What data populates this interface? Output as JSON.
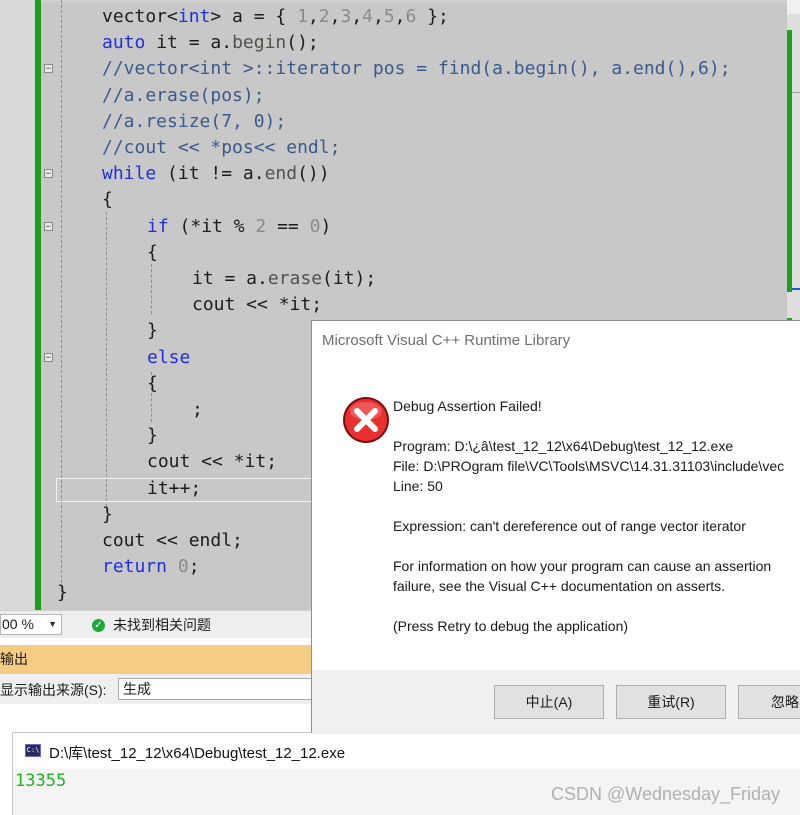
{
  "editor": {
    "lines": [
      {
        "indent": 0,
        "tokens": [
          {
            "t": "vector<"
          },
          {
            "t": "int",
            "c": "kw"
          },
          {
            "t": "> a = { "
          },
          {
            "t": "1",
            "c": "num"
          },
          {
            "t": ","
          },
          {
            "t": "2",
            "c": "num"
          },
          {
            "t": ","
          },
          {
            "t": "3",
            "c": "num"
          },
          {
            "t": ","
          },
          {
            "t": "4",
            "c": "num"
          },
          {
            "t": ","
          },
          {
            "t": "5",
            "c": "num"
          },
          {
            "t": ","
          },
          {
            "t": "6",
            "c": "num"
          },
          {
            "t": " };"
          }
        ]
      },
      {
        "indent": 0,
        "tokens": [
          {
            "t": "auto",
            "c": "kw"
          },
          {
            "t": " it = a."
          },
          {
            "t": "begin",
            "c": "fn"
          },
          {
            "t": "();"
          }
        ]
      },
      {
        "indent": 0,
        "fold": true,
        "tokens": [
          {
            "t": "//vector<int >::iterator pos = find(a.begin(), a.end(),6);",
            "c": "cm"
          }
        ]
      },
      {
        "indent": 0,
        "tokens": [
          {
            "t": "//a.erase(pos);",
            "c": "cm"
          }
        ]
      },
      {
        "indent": 0,
        "tokens": [
          {
            "t": "//a.resize(7, 0);",
            "c": "cm"
          }
        ]
      },
      {
        "indent": 0,
        "tokens": [
          {
            "t": "//cout << *pos<< endl;",
            "c": "cm"
          }
        ]
      },
      {
        "indent": 0,
        "fold": true,
        "tokens": [
          {
            "t": "while",
            "c": "kw"
          },
          {
            "t": " (it != a."
          },
          {
            "t": "end",
            "c": "fn"
          },
          {
            "t": "())"
          }
        ]
      },
      {
        "indent": 0,
        "tokens": [
          {
            "t": "{"
          }
        ]
      },
      {
        "indent": 1,
        "fold": true,
        "tokens": [
          {
            "t": "if",
            "c": "kw"
          },
          {
            "t": " (*it % "
          },
          {
            "t": "2",
            "c": "num"
          },
          {
            "t": " == "
          },
          {
            "t": "0",
            "c": "num"
          },
          {
            "t": ")"
          }
        ]
      },
      {
        "indent": 1,
        "tokens": [
          {
            "t": "{"
          }
        ]
      },
      {
        "indent": 2,
        "tokens": [
          {
            "t": "it = a."
          },
          {
            "t": "erase",
            "c": "fn"
          },
          {
            "t": "(it);"
          }
        ]
      },
      {
        "indent": 2,
        "tokens": [
          {
            "t": "cout << *it;"
          }
        ]
      },
      {
        "indent": 1,
        "tokens": [
          {
            "t": "}"
          }
        ]
      },
      {
        "indent": 1,
        "fold": true,
        "tokens": [
          {
            "t": "else",
            "c": "kw"
          }
        ]
      },
      {
        "indent": 1,
        "tokens": [
          {
            "t": "{"
          }
        ]
      },
      {
        "indent": 2,
        "tokens": [
          {
            "t": ";"
          }
        ]
      },
      {
        "indent": 1,
        "tokens": [
          {
            "t": "}"
          }
        ]
      },
      {
        "indent": 1,
        "tokens": [
          {
            "t": "cout << *it;"
          }
        ]
      },
      {
        "indent": 1,
        "tokens": [
          {
            "t": "it++;"
          }
        ]
      },
      {
        "indent": 0,
        "tokens": [
          {
            "t": "}"
          }
        ]
      },
      {
        "indent": 0,
        "tokens": [
          {
            "t": "cout << endl;"
          }
        ]
      },
      {
        "indent": 0,
        "tokens": [
          {
            "t": "return",
            "c": "kw"
          },
          {
            "t": " "
          },
          {
            "t": "0",
            "c": "num"
          },
          {
            "t": ";"
          }
        ]
      },
      {
        "indent": -1,
        "tokens": [
          {
            "t": "}"
          }
        ]
      }
    ]
  },
  "statusbar": {
    "zoom": "00 %",
    "issues": "未找到相关问题"
  },
  "output": {
    "title": "输出",
    "source_label": "显示输出来源(S):",
    "source_value": "生成"
  },
  "dialog": {
    "title": "Microsoft Visual C++ Runtime Library",
    "heading": "Debug Assertion Failed!",
    "program": "Program: D:\\¿â\\test_12_12\\x64\\Debug\\test_12_12.exe",
    "file": "File: D:\\PROgram file\\VC\\Tools\\MSVC\\14.31.31103\\include\\vec",
    "line": "Line: 50",
    "expression": "Expression: can't dereference out of range vector iterator",
    "info1": "For information on how your program can cause an assertion",
    "info2": "failure, see the Visual C++ documentation on asserts.",
    "press": "(Press Retry to debug the application)",
    "buttons": {
      "abort": "中止(A)",
      "retry": "重试(R)",
      "ignore": "忽略"
    }
  },
  "console": {
    "title": "D:\\库\\test_12_12\\x64\\Debug\\test_12_12.exe",
    "output": "13355"
  },
  "watermark": "CSDN @Wednesday_Friday",
  "colors": {
    "keyword": "#1e2fe0",
    "comment": "#3a5a8a",
    "number": "#8a8a8a",
    "console_text": "#22b022",
    "output_header": "#f5cc84"
  }
}
